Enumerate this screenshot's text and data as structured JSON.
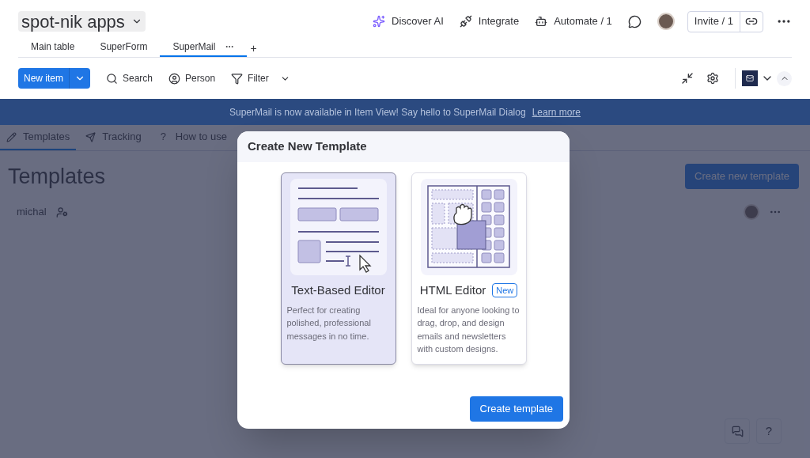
{
  "board": {
    "title": "spot-nik apps"
  },
  "top_actions": [
    {
      "kind": "ai",
      "label": "Discover AI"
    },
    {
      "kind": "integrate",
      "label": "Integrate"
    },
    {
      "kind": "automate",
      "label": "Automate / 1"
    }
  ],
  "invite": {
    "label": "Invite / 1"
  },
  "add_view": "+",
  "view_tabs": [
    {
      "label": "Main table",
      "selected": false
    },
    {
      "label": "SuperForm",
      "selected": false
    },
    {
      "label": "SuperMail",
      "selected": true
    }
  ],
  "toolbar": {
    "new_item": "New item",
    "items": [
      {
        "kind": "search",
        "label": "Search"
      },
      {
        "kind": "person",
        "label": "Person"
      },
      {
        "kind": "filter",
        "label": "Filter"
      }
    ]
  },
  "banner": {
    "text": "SuperMail is now available in Item View! Say hello to SuperMail Dialog",
    "link": "Learn more"
  },
  "app_tabs": [
    {
      "kind": "edit",
      "label": "Templates",
      "selected": true
    },
    {
      "kind": "send",
      "label": "Tracking",
      "selected": false
    },
    {
      "kind": "help",
      "glyph": "?",
      "label": "How to use",
      "selected": false
    }
  ],
  "page_title": "Templates",
  "create_button": "Create new template",
  "user_row": {
    "name": "michal"
  },
  "help_button": "?",
  "modal": {
    "title": "Create New Template",
    "options": [
      {
        "kind": "text",
        "title": "Text-Based Editor",
        "description": "Perfect for creating polished, professional messages in no time.",
        "selected": true
      },
      {
        "kind": "html",
        "title": "HTML Editor",
        "badge": "New",
        "description": "Ideal for anyone looking to drag, drop, and design emails and newsletters with custom designs.",
        "selected": false
      }
    ],
    "submit": "Create template"
  }
}
